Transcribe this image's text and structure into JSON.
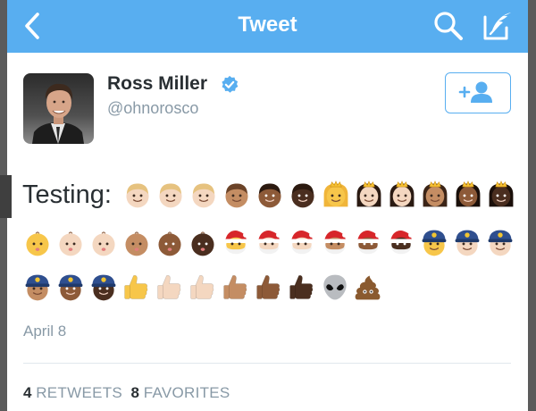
{
  "navbar": {
    "title": "Tweet",
    "icons": [
      "back-chevron-icon",
      "search-icon",
      "compose-icon"
    ],
    "color": "#58aef0"
  },
  "tweet": {
    "author": {
      "display_name": "Ross Miller",
      "handle": "@ohnorosco",
      "verified": true
    },
    "text": "Testing:",
    "emoji": [
      "man-medium-light-skin",
      "man-light-skin",
      "man-light-skin",
      "man-medium-skin",
      "man-medium-dark-skin",
      "man-dark-skin",
      "princess",
      "princess-light-skin",
      "princess-light-skin",
      "princess-medium-skin",
      "princess-medium-dark-skin",
      "princess-dark-skin",
      "baby",
      "baby-light-skin",
      "baby-light-skin",
      "baby-medium-skin",
      "baby-medium-dark-skin",
      "baby-dark-skin",
      "santa",
      "santa-light-skin",
      "santa-light-skin",
      "santa-medium-skin",
      "santa-medium-dark-skin",
      "santa-dark-skin",
      "police-officer",
      "police-officer-light-skin",
      "police-officer-light-skin",
      "police-officer-medium-skin",
      "police-officer-medium-dark-skin",
      "police-officer-dark-skin",
      "thumbs-up",
      "thumbs-up-light-skin",
      "thumbs-up-light-skin",
      "thumbs-up-medium-skin",
      "thumbs-up-medium-dark-skin",
      "thumbs-up-dark-skin",
      "alien",
      "pile-of-poo"
    ],
    "date": "April 8",
    "retweets": {
      "count": "4",
      "label": "RETWEETS"
    },
    "favorites": {
      "count": "8",
      "label": "FAVORITES"
    }
  },
  "colors": {
    "accent": "#58aef0",
    "text": "#292f33",
    "muted": "#8899a6",
    "divider": "#e1e8ed"
  }
}
